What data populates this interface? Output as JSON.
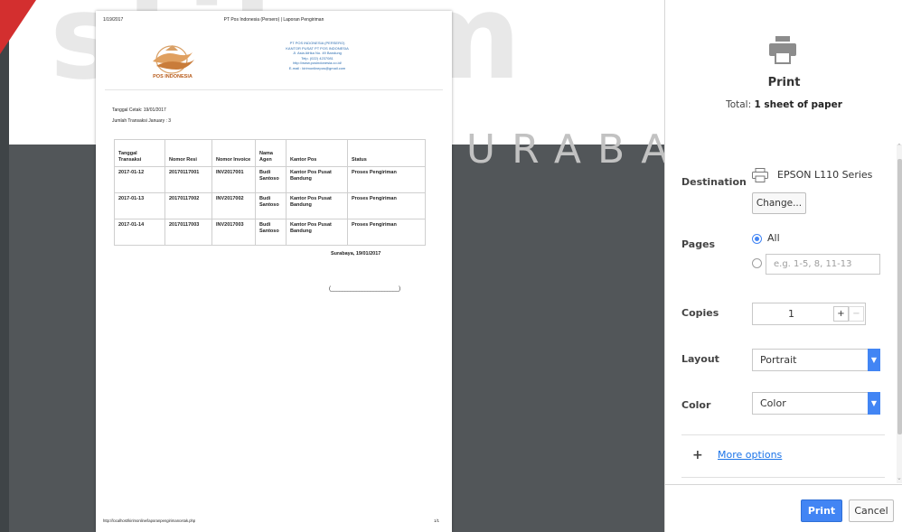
{
  "watermark": {
    "word": "stikom",
    "subword": "SURABAYA"
  },
  "paper": {
    "date": "1/19/2017",
    "header_title": "PT Pos Indonesia (Persero) | Laporan Pengiriman",
    "logo_text": "POS INDONESIA",
    "company": {
      "name": "PT POS INDONESIA (PERSERO)",
      "office": "KANTOR PUSAT PT POS INDONESIA",
      "address": "Jl. Asia Afrika No. 49 Bandung",
      "phone": "Telp. (022) 4237081",
      "website": "http://www.posindonesia.co.id/",
      "email": "E-mail : kirimonlinepos@gmail.com"
    },
    "print_date": "Tanggal Cetak: 19/01/2017",
    "transaction_count": "Jumlah Transaksi January : 3",
    "table": {
      "headers": [
        "Tanggal Transaksi",
        "Nomor Resi",
        "Nomor Invoice",
        "Nama Agen",
        "Kantor Pos",
        "Status"
      ],
      "rows": [
        [
          "2017-01-12",
          "20170117001",
          "INV2017001",
          "Budi Santoso",
          "Kantor Pos Pusat Bandung",
          "Proses Pengiriman"
        ],
        [
          "2017-01-13",
          "20170117002",
          "INV2017002",
          "Budi Santoso",
          "Kantor Pos Pusat Bandung",
          "Proses Pengiriman"
        ],
        [
          "2017-01-14",
          "20170117003",
          "INV2017003",
          "Budi Santoso",
          "Kantor Pos Pusat Bandung",
          "Proses Pengiriman"
        ]
      ]
    },
    "sign_place": "Surabaya, 19/01/2017",
    "sign_line": "(________________________)",
    "url": "http://localhost/kirimonline/laporanpengirimancetak.php",
    "page": "1/1"
  },
  "sidebar": {
    "heading": "Print",
    "total_prefix": "Total: ",
    "total_value": "1 sheet of paper",
    "destination": {
      "label": "Destination",
      "printer": "EPSON L110 Series",
      "change_label": "Change..."
    },
    "pages": {
      "label": "Pages",
      "all_label": "All",
      "custom_placeholder": "e.g. 1-5, 8, 11-13"
    },
    "copies": {
      "label": "Copies",
      "value": "1",
      "plus": "+",
      "minus": "−"
    },
    "layout": {
      "label": "Layout",
      "value": "Portrait"
    },
    "color": {
      "label": "Color",
      "value": "Color"
    },
    "more_options": {
      "icon": "+",
      "label": "More options"
    },
    "print_label": "Print",
    "cancel_label": "Cancel"
  },
  "colors": {
    "accent": "#4285f4",
    "link": "#1a73e8",
    "preview_bg": "#525659",
    "logo": "#b85c1b"
  }
}
